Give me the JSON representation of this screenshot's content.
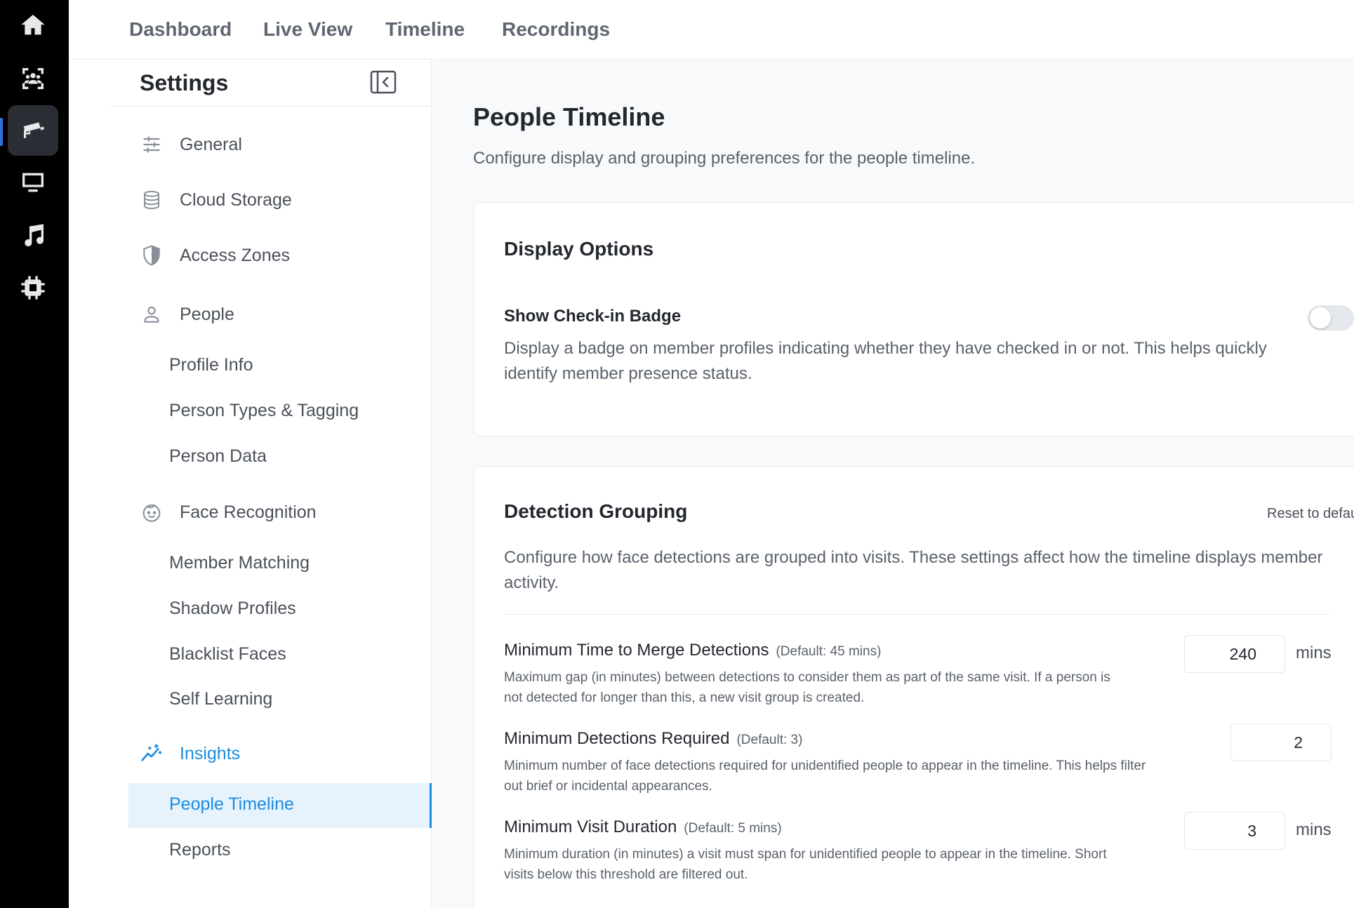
{
  "rail": {
    "items": [
      {
        "icon": "home-icon"
      },
      {
        "icon": "people-scan-icon"
      },
      {
        "icon": "camera-icon"
      },
      {
        "icon": "monitor-icon"
      },
      {
        "icon": "music-icon"
      },
      {
        "icon": "chip-icon"
      }
    ],
    "active_index": 2
  },
  "topnav": {
    "tabs": [
      "Dashboard",
      "Live View",
      "Timeline",
      "Recordings"
    ]
  },
  "sidebar": {
    "title": "Settings",
    "sections": {
      "general": "General",
      "cloud_storage": "Cloud Storage",
      "access_zones": "Access Zones",
      "people": "People",
      "people_sub": [
        "Profile Info",
        "Person Types & Tagging",
        "Person Data"
      ],
      "face_recognition": "Face Recognition",
      "face_sub": [
        "Member Matching",
        "Shadow Profiles",
        "Blacklist Faces",
        "Self Learning"
      ],
      "insights": "Insights",
      "insights_sub": [
        "People Timeline",
        "Reports"
      ]
    },
    "active_item": "People Timeline"
  },
  "main": {
    "title": "People Timeline",
    "subtitle": "Configure display and grouping preferences for the people timeline.",
    "display_options": {
      "title": "Display Options",
      "show_badge_label": "Show Check-in Badge",
      "show_badge_desc": "Display a badge on member profiles indicating whether they have checked in or not. This helps quickly identify member presence status.",
      "show_badge_enabled": false
    },
    "detection_grouping": {
      "title": "Detection Grouping",
      "reset_label": "Reset to defaults",
      "description": "Configure how face detections are grouped into visits. These settings affect how the timeline displays member activity.",
      "fields": [
        {
          "label": "Minimum Time to Merge Detections",
          "default": "(Default: 45 mins)",
          "desc_line1": "Maximum gap (in minutes) between detections to consider them as part of the same visit. If a person is",
          "desc_line2": "not detected for longer than this, a new visit group is created.",
          "value": "240",
          "unit": "mins"
        },
        {
          "label": "Minimum Detections Required",
          "default": "(Default: 3)",
          "desc_line1": "Minimum number of face detections required for unidentified people to appear in the timeline. This helps filter",
          "desc_line2": "out brief or incidental appearances.",
          "value": "2",
          "unit": ""
        },
        {
          "label": "Minimum Visit Duration",
          "default": "(Default: 5 mins)",
          "desc_line1": "Minimum duration (in minutes) a visit must span for unidentified people to appear in the timeline. Short",
          "desc_line2": "visits below this threshold are filtered out.",
          "value": "3",
          "unit": "mins"
        }
      ]
    }
  },
  "colors": {
    "accent": "#1d8ce0",
    "rail_bg": "#000000",
    "active_bg": "#e6f2fc"
  }
}
